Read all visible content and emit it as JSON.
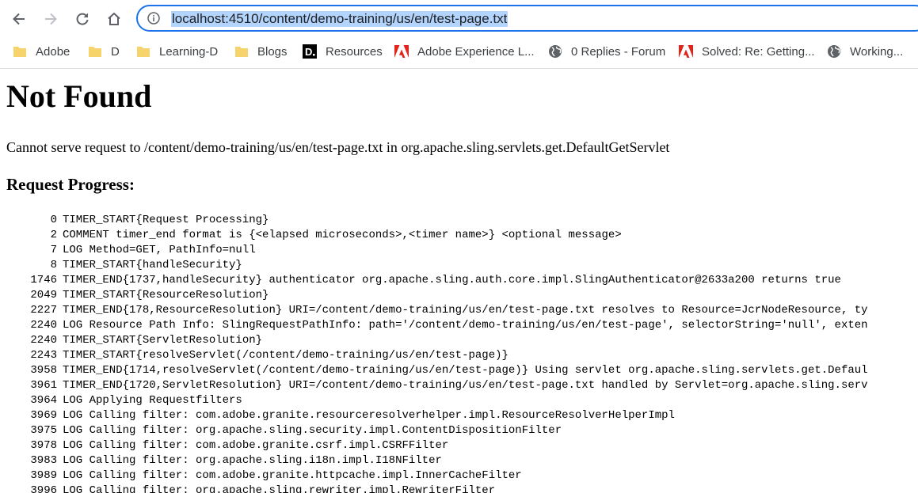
{
  "browser": {
    "url": "localhost:4510/content/demo-training/us/en/test-page.txt"
  },
  "bookmarks": [
    {
      "label": "Adobe",
      "icon": "folder-icon"
    },
    {
      "label": "D",
      "icon": "folder-icon"
    },
    {
      "label": "Learning-D",
      "icon": "folder-icon"
    },
    {
      "label": "Blogs",
      "icon": "folder-icon"
    },
    {
      "label": "Resources",
      "icon": "d-logo-icon"
    },
    {
      "label": "Adobe Experience L...",
      "icon": "adobe-logo-icon"
    },
    {
      "label": "0 Replies - Forum",
      "icon": "globe-icon"
    },
    {
      "label": "Solved: Re: Getting...",
      "icon": "adobe-logo-icon"
    },
    {
      "label": "Working...",
      "icon": "globe-icon"
    }
  ],
  "page": {
    "title": "Not Found",
    "message": "Cannot serve request to /content/demo-training/us/en/test-page.txt in org.apache.sling.servlets.get.DefaultGetServlet",
    "progress_heading": "Request Progress:",
    "log": [
      {
        "t": "0",
        "text": "TIMER_START{Request Processing}"
      },
      {
        "t": "2",
        "text": "COMMENT timer_end format is {<elapsed microseconds>,<timer name>} <optional message>"
      },
      {
        "t": "7",
        "text": "LOG Method=GET, PathInfo=null"
      },
      {
        "t": "8",
        "text": "TIMER_START{handleSecurity}"
      },
      {
        "t": "1746",
        "text": "TIMER_END{1737,handleSecurity} authenticator org.apache.sling.auth.core.impl.SlingAuthenticator@2633a200 returns true"
      },
      {
        "t": "2049",
        "text": "TIMER_START{ResourceResolution}"
      },
      {
        "t": "2227",
        "text": "TIMER_END{178,ResourceResolution} URI=/content/demo-training/us/en/test-page.txt resolves to Resource=JcrNodeResource, ty"
      },
      {
        "t": "2240",
        "text": "LOG Resource Path Info: SlingRequestPathInfo: path='/content/demo-training/us/en/test-page', selectorString='null', exten"
      },
      {
        "t": "2240",
        "text": "TIMER_START{ServletResolution}"
      },
      {
        "t": "2243",
        "text": "TIMER_START{resolveServlet(/content/demo-training/us/en/test-page)}"
      },
      {
        "t": "3958",
        "text": "TIMER_END{1714,resolveServlet(/content/demo-training/us/en/test-page)} Using servlet org.apache.sling.servlets.get.Defaul"
      },
      {
        "t": "3961",
        "text": "TIMER_END{1720,ServletResolution} URI=/content/demo-training/us/en/test-page.txt handled by Servlet=org.apache.sling.serv"
      },
      {
        "t": "3964",
        "text": "LOG Applying Requestfilters"
      },
      {
        "t": "3969",
        "text": "LOG Calling filter: com.adobe.granite.resourceresolverhelper.impl.ResourceResolverHelperImpl"
      },
      {
        "t": "3975",
        "text": "LOG Calling filter: org.apache.sling.security.impl.ContentDispositionFilter"
      },
      {
        "t": "3978",
        "text": "LOG Calling filter: com.adobe.granite.csrf.impl.CSRFFilter"
      },
      {
        "t": "3983",
        "text": "LOG Calling filter: org.apache.sling.i18n.impl.I18NFilter"
      },
      {
        "t": "3989",
        "text": "LOG Calling filter: com.adobe.granite.httpcache.impl.InnerCacheFilter"
      },
      {
        "t": "3996",
        "text": "LOG Calling filter: org.apache.sling.rewriter.impl.RewriterFilter"
      }
    ]
  }
}
